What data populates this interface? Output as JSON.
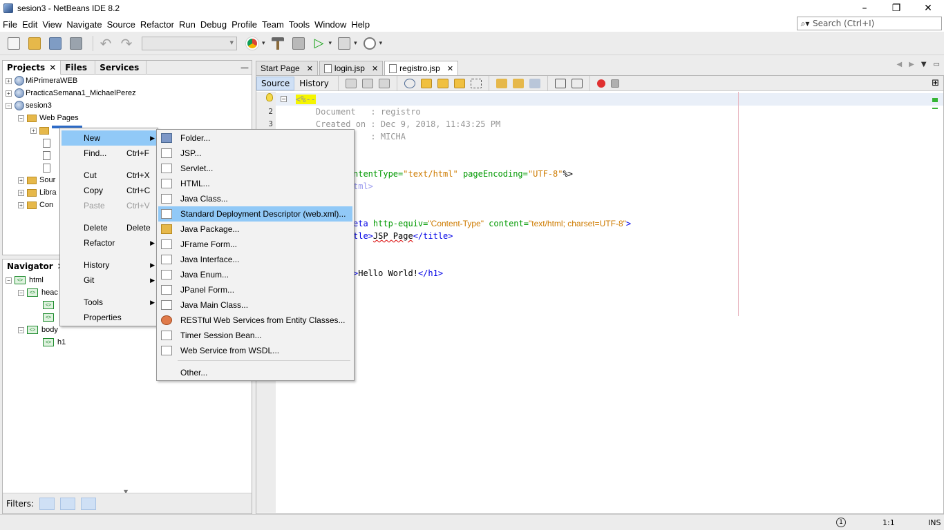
{
  "window": {
    "title": "sesion3 - NetBeans IDE 8.2",
    "controls": [
      "–",
      "❐",
      "✕"
    ]
  },
  "menubar": [
    "File",
    "Edit",
    "View",
    "Navigate",
    "Source",
    "Refactor",
    "Run",
    "Debug",
    "Profile",
    "Team",
    "Tools",
    "Window",
    "Help"
  ],
  "search": {
    "placeholder": "Search (Ctrl+I)"
  },
  "left_tabs": {
    "projects": "Projects",
    "files": "Files",
    "services": "Services"
  },
  "project_tree": {
    "p1": "MiPrimeraWEB",
    "p2": "PracticaSemana1_MichaelPerez",
    "p3": "sesion3",
    "web_pages": "Web Pages",
    "sources": "Sour",
    "libraries": "Libra",
    "config": "Con"
  },
  "navigator": {
    "title": "Navigator",
    "html": "html",
    "head": "heac",
    "body": "body",
    "h1": "h1",
    "filters_label": "Filters:"
  },
  "editor_tabs": {
    "start": "Start Page",
    "login": "login.jsp",
    "registro": "registro.jsp"
  },
  "editor_toolbar": {
    "source": "Source",
    "history": "History"
  },
  "code": {
    "l1": "<%--",
    "l2": "    Document   : registro",
    "l3": "    Created on : Dec 9, 2018, 11:43:25 PM",
    "l4": "               : MICHA",
    "l7a": "ntentType=",
    "l7b": "\"text/html\"",
    "l7c": " pageEncoding=",
    "l7d": "\"UTF-8\"",
    "l7e": "%>",
    "l8": "tml>",
    "l11a": "eta ",
    "l11b": "http-equiv=",
    "l11c": "\"Content-Type\"",
    "l11d": " content=",
    "l11e": "\"text/html; charset=UTF-8\"",
    "l11f": ">",
    "l12a": "tle>",
    "l12b": "JSP Page",
    "l12c": "</title>",
    "l15a": ">",
    "l15b": "Hello World!",
    "l15c": "</h1>"
  },
  "line_numbers": [
    "1",
    "2",
    "3"
  ],
  "context_menu": {
    "new": "New",
    "find": "Find...",
    "find_sc": "Ctrl+F",
    "cut": "Cut",
    "cut_sc": "Ctrl+X",
    "copy": "Copy",
    "copy_sc": "Ctrl+C",
    "paste": "Paste",
    "paste_sc": "Ctrl+V",
    "delete": "Delete",
    "delete_sc": "Delete",
    "refactor": "Refactor",
    "history": "History",
    "git": "Git",
    "tools": "Tools",
    "properties": "Properties"
  },
  "new_submenu": {
    "folder": "Folder...",
    "jsp": "JSP...",
    "servlet": "Servlet...",
    "html": "HTML...",
    "java_class": "Java Class...",
    "web_xml": "Standard Deployment Descriptor (web.xml)...",
    "java_package": "Java Package...",
    "jframe": "JFrame Form...",
    "java_interface": "Java Interface...",
    "java_enum": "Java Enum...",
    "jpanel": "JPanel Form...",
    "java_main": "Java Main Class...",
    "restful": "RESTful Web Services from Entity Classes...",
    "timer": "Timer Session Bean...",
    "ws_wsdl": "Web Service from WSDL...",
    "other": "Other..."
  },
  "status": {
    "notifications": "1",
    "position": "1:1",
    "mode": "INS"
  },
  "colors": {
    "highlight": "#91c9f7",
    "tag": "#0000e6",
    "attribute": "#009900",
    "string": "#ce7b00",
    "comment": "#969696"
  }
}
